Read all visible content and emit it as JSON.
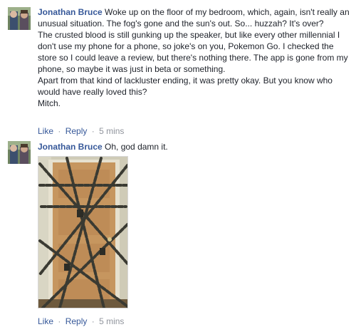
{
  "comments": [
    {
      "author": "Jonathan Bruce",
      "paragraphs": [
        "Woke up on the floor of my bedroom, which, again, isn't really an unusual situation. The fog's gone and the sun's out. So... huzzah? It's over?",
        "The crusted blood is still gunking up the speaker, but like every other millennial I don't use my phone for a phone, so joke's on you, Pokemon Go. I checked the store so I could leave a review, but there's nothing there. The app is gone from my phone, so maybe it was just in beta or something.",
        "Apart from that kind of lackluster ending, it was pretty okay. But you know who would have really loved this?",
        "Mitch."
      ],
      "actions": {
        "like": "Like",
        "reply": "Reply",
        "separator": "·",
        "time": "5 mins"
      }
    },
    {
      "author": "Jonathan Bruce",
      "paragraphs": [
        "Oh, god damn it."
      ],
      "attachment": {
        "type": "photo",
        "subject": "door-wrapped-in-chains"
      },
      "actions": {
        "like": "Like",
        "reply": "Reply",
        "separator": "·",
        "time": "5 mins"
      }
    }
  ],
  "colors": {
    "author_link": "#365899",
    "meta_gray": "#90949c",
    "text": "#1d2129"
  }
}
